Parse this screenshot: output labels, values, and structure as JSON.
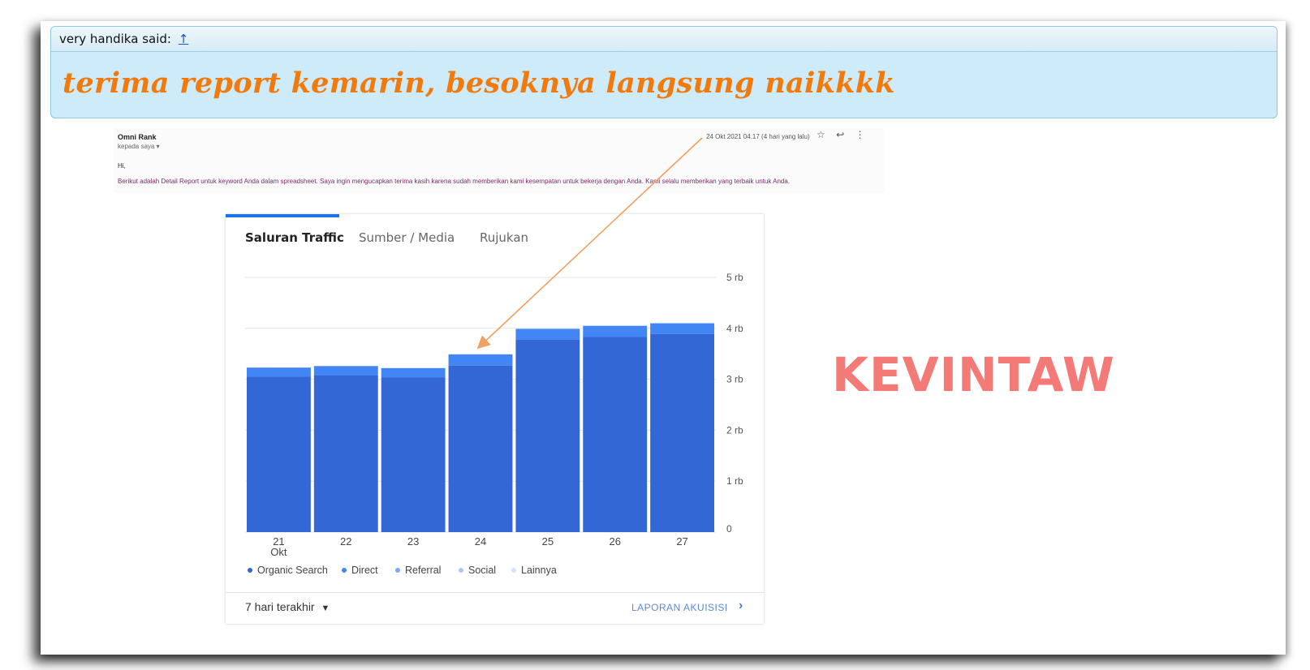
{
  "quote": {
    "author_line": "very handika said:",
    "up_arrow": "↑",
    "message": "terima report kemarin, besoknya langsung naikkkk"
  },
  "email": {
    "sender": "Omni Rank",
    "recipient": "kepada saya ▾",
    "date": "24 Okt 2021 04.17 (4 hari yang lalu)",
    "greeting": "Hi,",
    "body": "Berikut adalah Detail Report untuk keyword Anda dalam spreadsheet. Saya ingin mengucapkan terima kasih karena sudah memberikan kami kesempatan untuk bekerja dengan Anda. Kami selalu memberikan yang terbaik untuk Anda.",
    "icons": [
      "star-icon",
      "reply-icon",
      "more-vert-icon"
    ]
  },
  "analytics": {
    "tabs": [
      "Saluran Traffic",
      "Sumber / Media",
      "Rujukan"
    ],
    "active_tab": 0,
    "range_label": "7 hari terakhir",
    "report_link": "LAPORAN AKUISISI",
    "colors": {
      "organic": "#3367d6",
      "direct": "#4285f4",
      "referral": "#7baaf7",
      "social": "#a8c7fa",
      "other": "#d2e3fc"
    }
  },
  "chart_data": {
    "type": "bar",
    "stacked": true,
    "categories": [
      "21",
      "22",
      "23",
      "24",
      "25",
      "26",
      "27"
    ],
    "category_sublabels": [
      "Okt",
      "",
      "",
      "",
      "",
      "",
      ""
    ],
    "y_tick_labels": [
      "0",
      "1 rb",
      "2 rb",
      "3 rb",
      "4 rb",
      "5 rb"
    ],
    "ylim": [
      0,
      5000
    ],
    "legend": [
      "Organic Search",
      "Direct",
      "Referral",
      "Social",
      "Lainnya"
    ],
    "legend_position": "bottom-left",
    "series": [
      {
        "name": "Organic Search",
        "values": [
          3050,
          3080,
          3040,
          3270,
          3780,
          3830,
          3890
        ]
      },
      {
        "name": "Direct",
        "values": [
          180,
          180,
          180,
          220,
          210,
          220,
          210
        ]
      },
      {
        "name": "Referral",
        "values": [
          0,
          0,
          0,
          0,
          0,
          0,
          0
        ]
      },
      {
        "name": "Social",
        "values": [
          0,
          0,
          0,
          0,
          0,
          0,
          0
        ]
      },
      {
        "name": "Lainnya",
        "values": [
          0,
          0,
          0,
          0,
          0,
          0,
          0
        ]
      }
    ]
  },
  "watermark": "KEVINTAW"
}
